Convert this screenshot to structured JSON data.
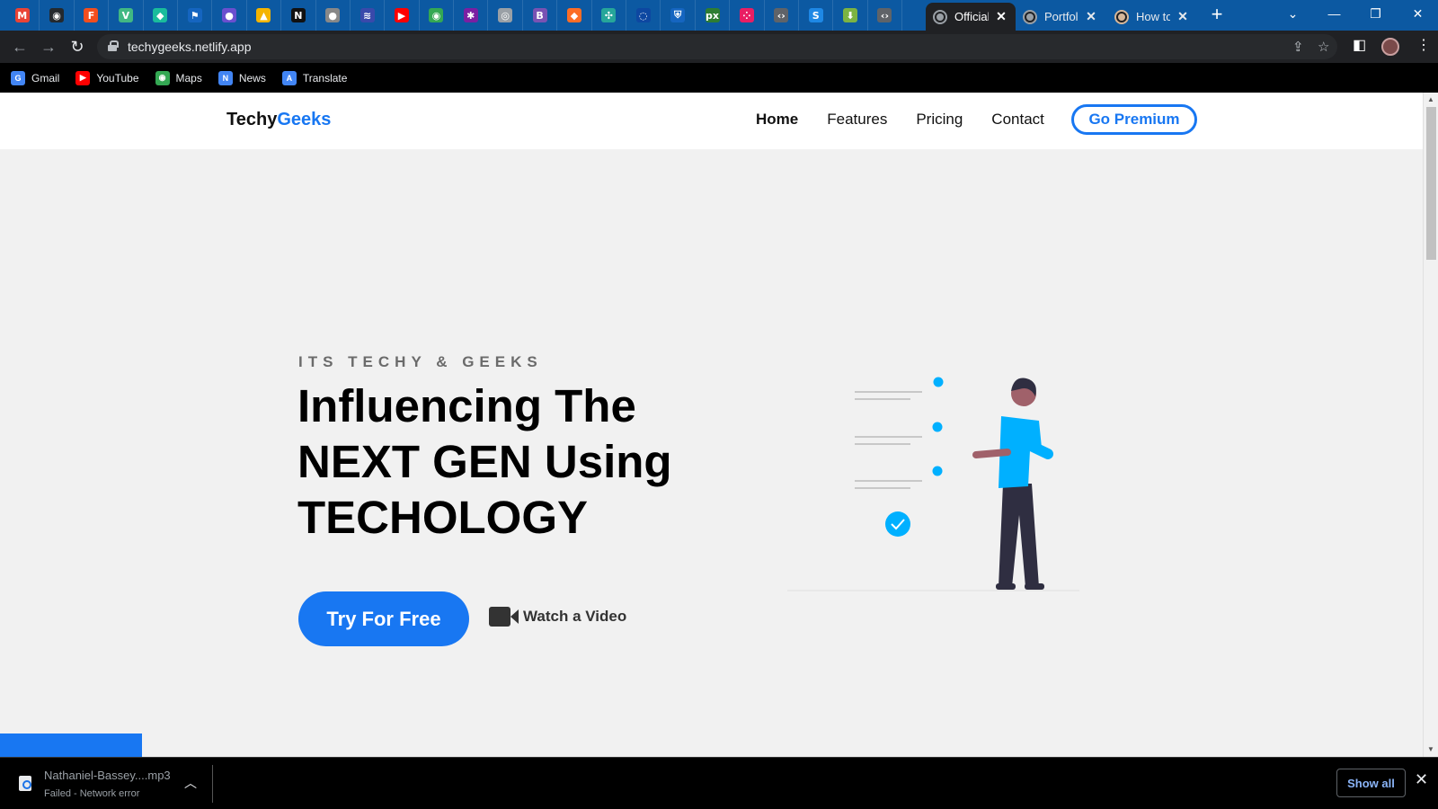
{
  "browser": {
    "pinned_tabs": [
      {
        "icon": "gmail-icon",
        "color": "#ea4335",
        "glyph": "M"
      },
      {
        "icon": "github-icon",
        "color": "#24292e",
        "glyph": "◉"
      },
      {
        "icon": "figma-icon",
        "color": "#f24e1e",
        "glyph": "F"
      },
      {
        "icon": "vue-icon",
        "color": "#41b883",
        "glyph": "V"
      },
      {
        "icon": "diamond-icon",
        "color": "#1abc9c",
        "glyph": "◆"
      },
      {
        "icon": "flag-icon",
        "color": "#1565c0",
        "glyph": "⚑"
      },
      {
        "icon": "circle-app-icon",
        "color": "#6a4fcf",
        "glyph": "●"
      },
      {
        "icon": "google-drive-icon",
        "color": "#f4b400",
        "glyph": "▲"
      },
      {
        "icon": "notion-icon",
        "color": "#111111",
        "glyph": "N"
      },
      {
        "icon": "gray-circle-icon",
        "color": "#888888",
        "glyph": "●"
      },
      {
        "icon": "wifi-icon",
        "color": "#3949ab",
        "glyph": "≋"
      },
      {
        "icon": "youtube-icon",
        "color": "#ff0000",
        "glyph": "▶"
      },
      {
        "icon": "maps-pin-icon",
        "color": "#34a853",
        "glyph": "◉"
      },
      {
        "icon": "colorful-app-icon",
        "color": "#7b1fa2",
        "glyph": "✱"
      },
      {
        "icon": "globe-icon",
        "color": "#9aa0a6",
        "glyph": "◎"
      },
      {
        "icon": "bootstrap-icon",
        "color": "#7952b3",
        "glyph": "B"
      },
      {
        "icon": "gitlab-icon",
        "color": "#fc6d26",
        "glyph": "◆"
      },
      {
        "icon": "nodes-icon",
        "color": "#26a69a",
        "glyph": "✣"
      },
      {
        "icon": "spinner-icon",
        "color": "#0d47a1",
        "glyph": "◌"
      },
      {
        "icon": "shield-icon",
        "color": "#1565c0",
        "glyph": "⛨"
      },
      {
        "icon": "px-icon",
        "color": "#2e7d32",
        "glyph": "px"
      },
      {
        "icon": "dots-icon",
        "color": "#e91e63",
        "glyph": "⁘"
      },
      {
        "icon": "code-icon",
        "color": "#5f6368",
        "glyph": "‹›"
      },
      {
        "icon": "blue-logo-icon",
        "color": "#1e88e5",
        "glyph": "S"
      },
      {
        "icon": "download-arrow-icon",
        "color": "#7cb342",
        "glyph": "⬇"
      },
      {
        "icon": "code-icon",
        "color": "#5f6368",
        "glyph": "‹›"
      }
    ],
    "tabs": [
      {
        "title": "Official",
        "active": true
      },
      {
        "title": "Portfoli",
        "active": false
      },
      {
        "title": "How to",
        "active": false
      }
    ],
    "url": "techygeeks.netlify.app",
    "bookmarks": [
      {
        "label": "Gmail",
        "icon": "google-icon",
        "color": "#4285f4",
        "glyph": "G"
      },
      {
        "label": "YouTube",
        "icon": "youtube-icon",
        "color": "#ff0000",
        "glyph": "▶"
      },
      {
        "label": "Maps",
        "icon": "maps-pin-icon",
        "color": "#34a853",
        "glyph": "◉"
      },
      {
        "label": "News",
        "icon": "news-icon",
        "color": "#4285f4",
        "glyph": "N"
      },
      {
        "label": "Translate",
        "icon": "translate-icon",
        "color": "#4285f4",
        "glyph": "A"
      }
    ]
  },
  "site": {
    "brand_main": "Techy",
    "brand_accent": "Geeks",
    "nav": {
      "home": "Home",
      "features": "Features",
      "pricing": "Pricing",
      "contact": "Contact",
      "premium": "Go Premium"
    },
    "hero": {
      "eyebrow": "ITS TECHY & GEEKS",
      "headline_line1": "Influencing The",
      "headline_line2": "NEXT GEN Using",
      "headline_line3": "TECHOLOGY",
      "cta_primary": "Try For Free",
      "cta_secondary": "Watch a Video"
    },
    "colors": {
      "accent": "#1877f2",
      "background": "#f1f1f1",
      "illustration_blue": "#00b0ff"
    }
  },
  "downloads": {
    "file_name": "Nathaniel-Bassey....mp3",
    "status": "Failed - Network error",
    "show_all": "Show all"
  }
}
